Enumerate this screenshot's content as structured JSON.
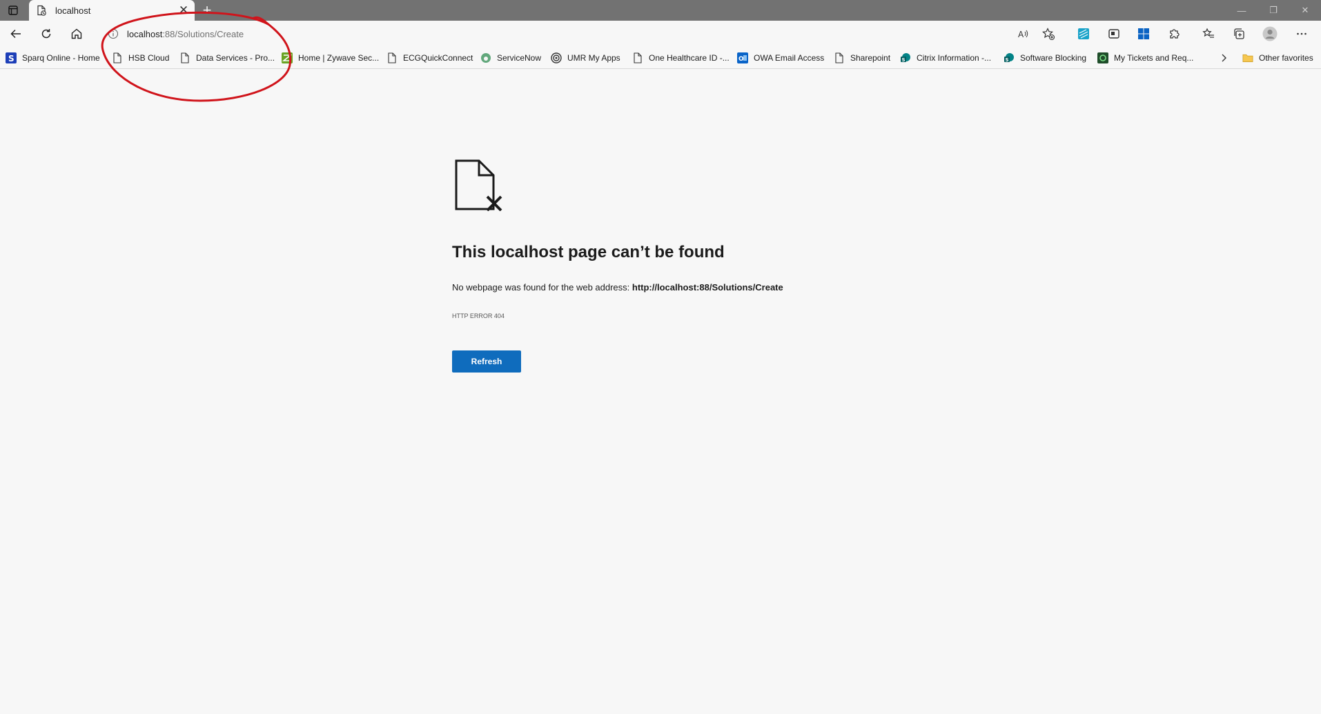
{
  "tab": {
    "title": "localhost"
  },
  "address": {
    "host": "localhost",
    "path": ":88/Solutions/Create"
  },
  "favorites": [
    {
      "label": "Sparq Online - Home",
      "icon": "sparq-icon"
    },
    {
      "label": "HSB Cloud",
      "icon": "page-icon"
    },
    {
      "label": "Data Services - Pro...",
      "icon": "page-icon"
    },
    {
      "label": "Home | Zywave Sec...",
      "icon": "zywave-icon"
    },
    {
      "label": "ECGQuickConnect",
      "icon": "page-icon"
    },
    {
      "label": "ServiceNow",
      "icon": "servicenow-icon"
    },
    {
      "label": "UMR My Apps",
      "icon": "umr-icon"
    },
    {
      "label": "One Healthcare ID -...",
      "icon": "page-icon"
    },
    {
      "label": "OWA Email Access",
      "icon": "outlook-icon"
    },
    {
      "label": "Sharepoint",
      "icon": "page-icon"
    },
    {
      "label": "Citrix Information -...",
      "icon": "sharepoint-icon"
    },
    {
      "label": "Software Blocking",
      "icon": "sharepoint-icon"
    },
    {
      "label": "My Tickets and Req...",
      "icon": "tickets-icon"
    }
  ],
  "other_favorites": "Other favorites",
  "error": {
    "title": "This localhost page can’t be found",
    "desc_prefix": "No webpage was found for the web address: ",
    "desc_url": "http://localhost:88/Solutions/Create",
    "code": "HTTP ERROR 404",
    "refresh_label": "Refresh"
  },
  "colors": {
    "accent": "#0f6cbd",
    "annotation": "#d0141b",
    "tabstrip": "#727272"
  }
}
